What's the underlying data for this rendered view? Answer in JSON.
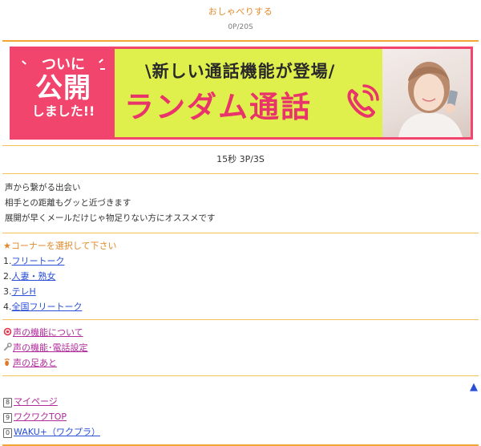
{
  "header": {
    "title": "おしゃべりする",
    "points": "0P/20S"
  },
  "banner": {
    "badge_line1": "ついに",
    "badge_line2": "公開",
    "badge_line3": "しました!!",
    "tagline": "\\新しい通話機能が登場/",
    "headline": "ランダム通話"
  },
  "rate": "15秒 3P/3S",
  "intro": {
    "lines": [
      "声から繋がる出会い",
      "相手との距離もグッと近づきます",
      "展開が早くメールだけじゃ物足りない方にオススメです"
    ]
  },
  "corners": {
    "heading": "★コーナーを選択して下さい",
    "items": [
      {
        "num": "1.",
        "label": "フリートーク"
      },
      {
        "num": "2.",
        "label": "人妻・熟女"
      },
      {
        "num": "3.",
        "label": "テレH"
      },
      {
        "num": "4.",
        "label": "全国フリートーク"
      }
    ]
  },
  "voice_links": {
    "about": "声の機能について",
    "settings": "声の機能･電話設定",
    "footprints": "声の足あと"
  },
  "footer": {
    "up_arrow": "▲",
    "mypage": {
      "num": "8",
      "label": "マイページ"
    },
    "top": {
      "num": "9",
      "label": "ワクワクTOP"
    },
    "waku": {
      "num": "0",
      "label": "WAKU+（ワクプラ）"
    }
  },
  "colors": {
    "accent_orange": "#f3a534",
    "banner_pink": "#f1456d",
    "banner_lime": "#dff04c",
    "link_blue": "#2a4fd6",
    "link_purple": "#b02a9a"
  }
}
